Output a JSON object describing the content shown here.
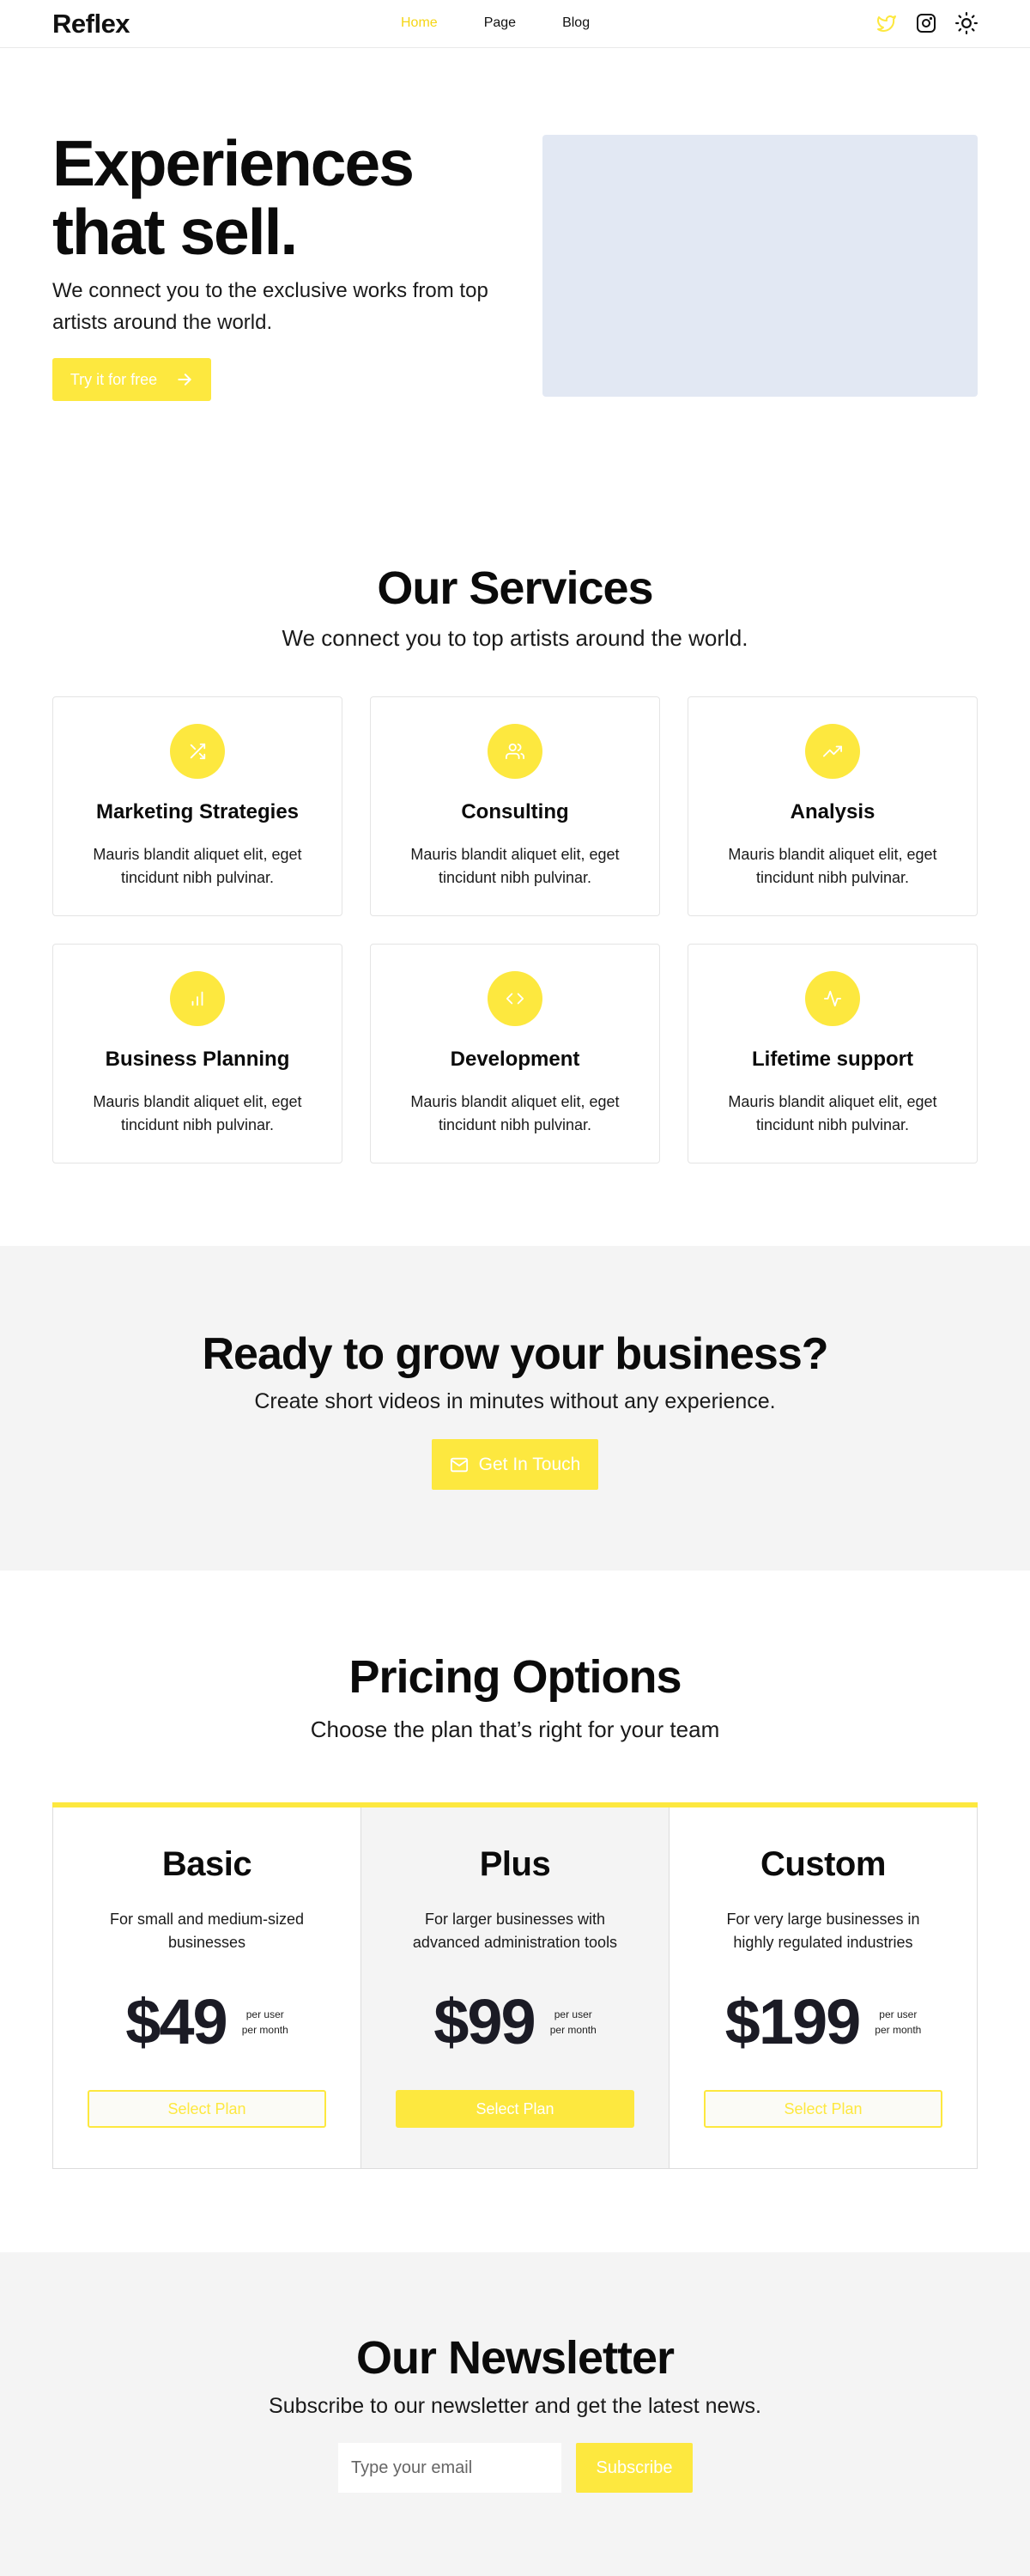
{
  "nav": {
    "logo": "Reflex",
    "links": [
      {
        "label": "Home",
        "active": true
      },
      {
        "label": "Page",
        "active": false
      },
      {
        "label": "Blog",
        "active": false
      }
    ],
    "icons": [
      "twitter-icon",
      "instagram-icon",
      "sun-icon"
    ]
  },
  "hero": {
    "title_line1": "Experiences",
    "title_line2": "that sell.",
    "subtitle": "We connect you to the exclusive works from top artists around the world.",
    "button_label": "Try it for free"
  },
  "services": {
    "title": "Our Services",
    "subtitle": "We connect you to top artists around the world.",
    "items": [
      {
        "icon": "shuffle-icon",
        "title": "Marketing Strategies",
        "text": "Mauris blandit aliquet elit, eget tincidunt nibh pulvinar."
      },
      {
        "icon": "users-icon",
        "title": "Consulting",
        "text": "Mauris blandit aliquet elit, eget tincidunt nibh pulvinar."
      },
      {
        "icon": "trending-up-icon",
        "title": "Analysis",
        "text": "Mauris blandit aliquet elit, eget tincidunt nibh pulvinar."
      },
      {
        "icon": "bar-chart-icon",
        "title": "Business Planning",
        "text": "Mauris blandit aliquet elit, eget tincidunt nibh pulvinar."
      },
      {
        "icon": "code-icon",
        "title": "Development",
        "text": "Mauris blandit aliquet elit, eget tincidunt nibh pulvinar."
      },
      {
        "icon": "activity-icon",
        "title": "Lifetime support",
        "text": "Mauris blandit aliquet elit, eget tincidunt nibh pulvinar."
      }
    ]
  },
  "grow": {
    "title": "Ready to grow your business?",
    "subtitle": "Create short videos in minutes without any experience.",
    "button_label": "Get In Touch"
  },
  "pricing": {
    "title": "Pricing Options",
    "subtitle": "Choose the plan that’s right for your team",
    "plans": [
      {
        "name": "Basic",
        "desc": "For small and medium-sized businesses",
        "price": "$49",
        "period_line1": "per user",
        "period_line2": "per month",
        "button": "Select Plan",
        "highlight": false
      },
      {
        "name": "Plus",
        "desc": "For larger businesses with advanced administration tools",
        "price": "$99",
        "period_line1": "per user",
        "period_line2": "per month",
        "button": "Select Plan",
        "highlight": true
      },
      {
        "name": "Custom",
        "desc": "For very large businesses in highly regulated industries",
        "price": "$199",
        "period_line1": "per user",
        "period_line2": "per month",
        "button": "Select Plan",
        "highlight": false
      }
    ]
  },
  "newsletter": {
    "title": "Our Newsletter",
    "subtitle": "Subscribe to our newsletter and get the latest news.",
    "input_placeholder": "Type your email",
    "button_label": "Subscribe"
  },
  "colors": {
    "accent": "#fde83f",
    "hero_image_bg": "#e2e8f3",
    "section_bg": "#f4f4f4"
  }
}
